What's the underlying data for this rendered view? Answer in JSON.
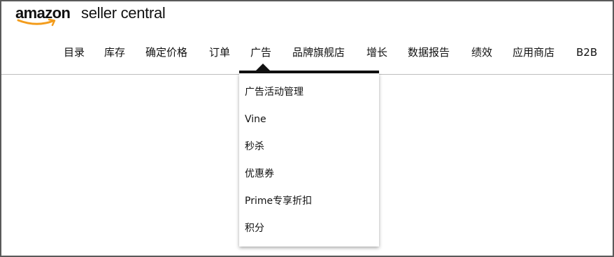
{
  "logo": {
    "brand": "amazon",
    "product": "seller central"
  },
  "nav": {
    "items": [
      {
        "label": "目录"
      },
      {
        "label": "库存"
      },
      {
        "label": "确定价格"
      },
      {
        "label": "订单"
      },
      {
        "label": "广告"
      },
      {
        "label": "品牌旗舰店"
      },
      {
        "label": "增长"
      },
      {
        "label": "数据报告"
      },
      {
        "label": "绩效"
      },
      {
        "label": "应用商店"
      },
      {
        "label": "B2B"
      }
    ],
    "active": "广告"
  },
  "dropdown": {
    "items": [
      {
        "label": "广告活动管理"
      },
      {
        "label": "Vine"
      },
      {
        "label": "秒杀"
      },
      {
        "label": "优惠券"
      },
      {
        "label": "Prime专享折扣"
      },
      {
        "label": "积分"
      }
    ]
  },
  "colors": {
    "logo_smile": "#f39c1c",
    "text": "#111111",
    "divider": "#bdbdbd"
  }
}
